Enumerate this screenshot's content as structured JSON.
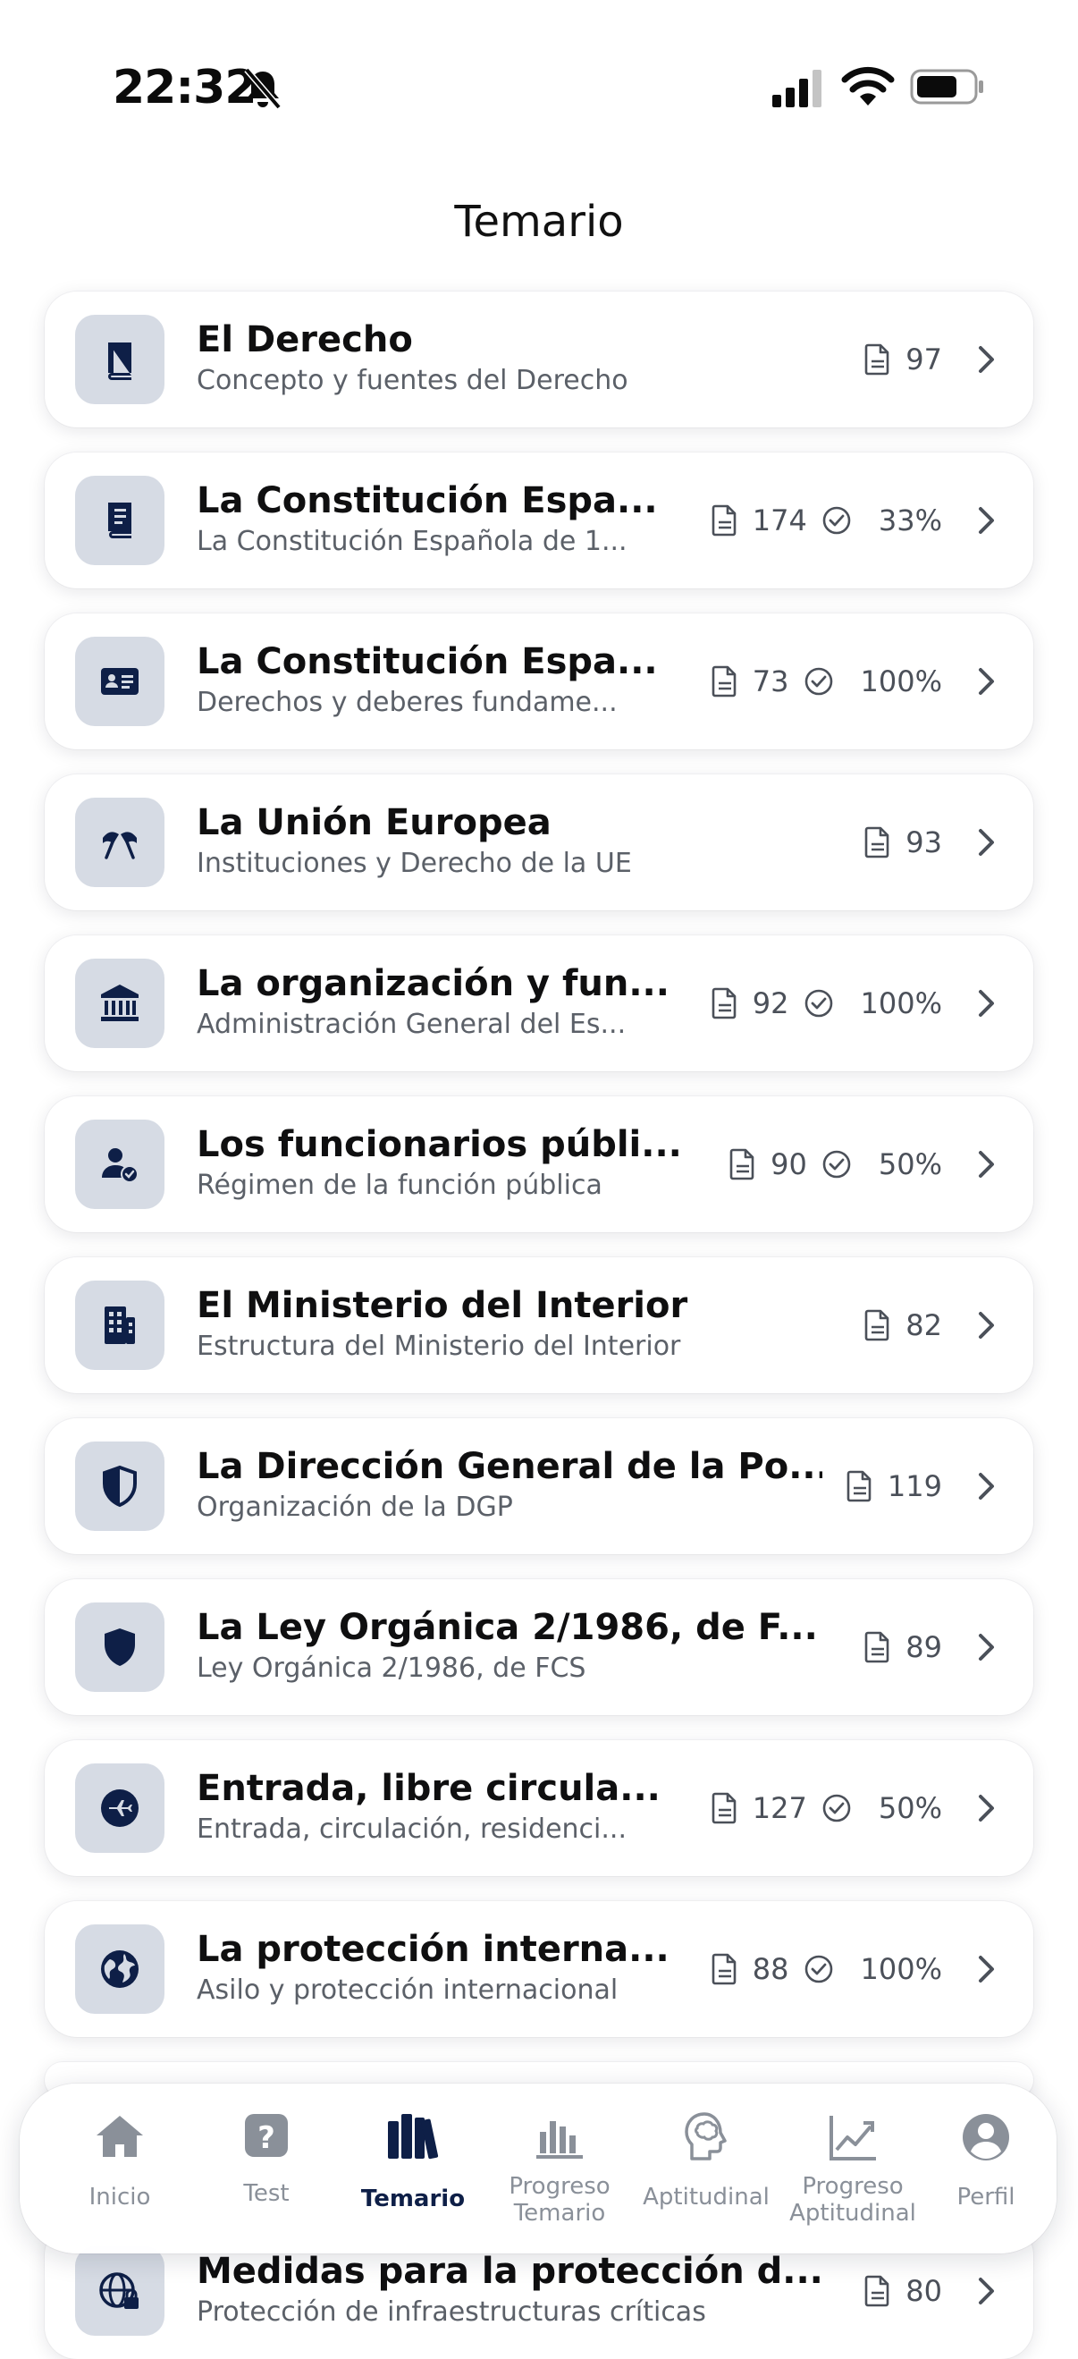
{
  "status_bar": {
    "time": "22:32"
  },
  "page": {
    "title": "Temario"
  },
  "topics": [
    {
      "title": "El Derecho",
      "subtitle": "Concepto y fuentes del Derecho",
      "count": "97",
      "progress": "",
      "icon": "book-icon"
    },
    {
      "title": "La Constitución Espa...",
      "subtitle": "La Constitución Española de 1...",
      "count": "174",
      "progress": "33%",
      "icon": "document-book-icon"
    },
    {
      "title": "La Constitución Espa...",
      "subtitle": "Derechos y deberes fundame...",
      "count": "73",
      "progress": "100%",
      "icon": "id-card-icon"
    },
    {
      "title": "La Unión Europea",
      "subtitle": "Instituciones y Derecho de la UE",
      "count": "93",
      "progress": "",
      "icon": "flags-icon"
    },
    {
      "title": "La organización y fun...",
      "subtitle": "Administración General del Es...",
      "count": "92",
      "progress": "100%",
      "icon": "government-building-icon"
    },
    {
      "title": "Los funcionarios públi...",
      "subtitle": "Régimen de la función pública",
      "count": "90",
      "progress": "50%",
      "icon": "verified-user-icon"
    },
    {
      "title": "El Ministerio del Interior",
      "subtitle": "Estructura del Ministerio del Interior",
      "count": "82",
      "progress": "",
      "icon": "office-building-icon"
    },
    {
      "title": "La Dirección General de la Po...",
      "subtitle": "Organización de la DGP",
      "count": "119",
      "progress": "",
      "icon": "half-shield-icon"
    },
    {
      "title": "La Ley Orgánica 2/1986, de F...",
      "subtitle": "Ley Orgánica 2/1986, de FCS",
      "count": "89",
      "progress": "",
      "icon": "shield-icon"
    },
    {
      "title": "Entrada, libre circula...",
      "subtitle": "Entrada, circulación, residenci...",
      "count": "127",
      "progress": "50%",
      "icon": "plane-circle-icon"
    },
    {
      "title": "La protección interna...",
      "subtitle": "Asilo y protección internacional",
      "count": "88",
      "progress": "100%",
      "icon": "globe-icon"
    }
  ],
  "last_topic": {
    "title": "Medidas para la protección d...",
    "subtitle": "Protección de infraestructuras críticas",
    "count": "80",
    "icon": "globe-lock-icon"
  },
  "nav": {
    "inicio": "Inicio",
    "test": "Test",
    "temario": "Temario",
    "progreso_temario_1": "Progreso",
    "progreso_temario_2": "Temario",
    "aptitudinal": "Aptitudinal",
    "progreso_aptitudinal_1": "Progreso",
    "progreso_aptitudinal_2": "Aptitudinal",
    "perfil": "Perfil"
  },
  "colors": {
    "accent": "#0e1f47",
    "icon_bg": "#d6dbe4",
    "muted": "#8a9099"
  }
}
